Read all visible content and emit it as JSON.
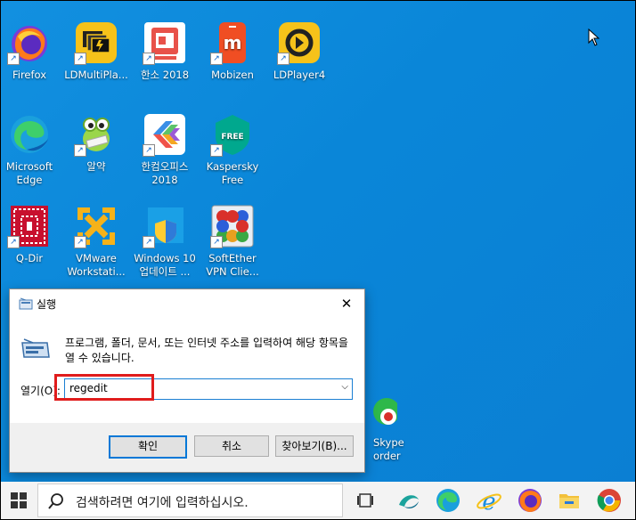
{
  "desktop": {
    "icons": [
      {
        "label": "Firefox"
      },
      {
        "label": "LDMultiPla..."
      },
      {
        "label": "한소 2018"
      },
      {
        "label": "Mobizen"
      },
      {
        "label": "LDPlayer4"
      },
      {
        "label": "Microsoft\nEdge"
      },
      {
        "label": "알약"
      },
      {
        "label": "한컴오피스\n2018"
      },
      {
        "label": "Kaspersky\nFree"
      },
      {
        "label": "Q-Dir"
      },
      {
        "label": "VMware\nWorkstati..."
      },
      {
        "label": "Windows 10\n업데이트 ..."
      },
      {
        "label": "SoftEther\nVPN Clie..."
      },
      {
        "label": "Skype\norder"
      }
    ],
    "kaspersky_badge": "FREE"
  },
  "run_dialog": {
    "title": "실행",
    "description": "프로그램, 폴더, 문서, 또는 인터넷 주소를 입력하여 해당 항목을 열 수 있습니다.",
    "open_label": "열기(O):",
    "open_value": "regedit",
    "ok_label": "확인",
    "cancel_label": "취소",
    "browse_label": "찾아보기(B)..."
  },
  "taskbar": {
    "search_placeholder": "검색하려면 여기에 입력하십시오."
  },
  "colors": {
    "desktop": "#0a86d8",
    "highlight": "#e01c1c",
    "accent": "#0078d7"
  }
}
